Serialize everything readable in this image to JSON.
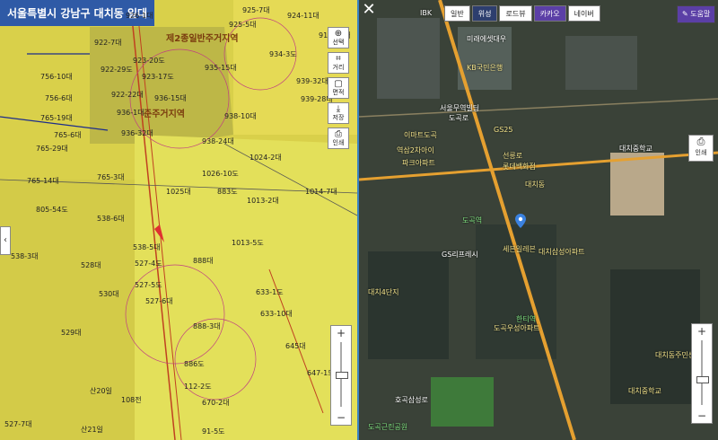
{
  "left_map": {
    "title": "서울특별시 강남구 대치동 일대",
    "zone_labels": [
      "제2종일반주거지역",
      "준주거지역"
    ],
    "parcels": [
      "926-1대",
      "925-7대",
      "925-5대",
      "922-7대",
      "923-20도",
      "922-29도",
      "923-17도",
      "922-22대",
      "936-15대",
      "935-15대",
      "934-3도",
      "939-32대",
      "936-1대",
      "936-32대",
      "938-10대",
      "938-24대",
      "765-6대",
      "765-29대",
      "765-14대",
      "765-3대",
      "756-10대",
      "756-6대",
      "765-19대",
      "1024-2대",
      "1026-10도",
      "1025대",
      "883도",
      "1013-2대",
      "1014-7대",
      "538-6대",
      "538-5대",
      "538-3대",
      "527-4도",
      "528대",
      "527-5도",
      "527-6대",
      "530대",
      "529대",
      "888대",
      "1013-5도",
      "633-1도",
      "633-10대",
      "888-3대",
      "645대",
      "886도",
      "647-1도",
      "112-2도",
      "670-2대",
      "산20일",
      "108전",
      "527-7대",
      "산21일",
      "91-5도",
      "805-54도",
      "924-11대",
      "919-17대",
      "939-28대"
    ],
    "tools": [
      {
        "icon": "⊕",
        "label": "선택"
      },
      {
        "icon": "⌗",
        "label": "거리"
      },
      {
        "icon": "▢",
        "label": "면적"
      },
      {
        "icon": "⤓",
        "label": "저장"
      },
      {
        "icon": "⎙",
        "label": "인쇄"
      }
    ],
    "zoom": {
      "plus": "+",
      "minus": "−",
      "level": 0.5
    }
  },
  "right_map": {
    "close": "✕",
    "buttons": [
      {
        "label": "일반",
        "selected": false
      },
      {
        "label": "위성",
        "selected": true
      },
      {
        "label": "로드뷰",
        "selected": false
      },
      {
        "label": "카카오",
        "selected": true
      },
      {
        "label": "네이버",
        "selected": false
      }
    ],
    "help": "도움말",
    "print": "인쇄",
    "zoom": {
      "plus": "+",
      "minus": "−",
      "level": 0.4
    },
    "labels": [
      "IBK",
      "미래에셋대우",
      "KB국민은행",
      "서울무역빌딩",
      "도곡로",
      "GS25",
      "이마트도곡",
      "역삼2차아이",
      "파크아파트",
      "선릉로",
      "롯데백화점",
      "대치동",
      "대치중학교",
      "도곡역",
      "GS리프레시",
      "세븐일레븐",
      "대치삼성아파트",
      "한티역",
      "도곡우성아파트",
      "대치4단지",
      "대치동주민센터",
      "도곡근린공원",
      "대치중학교",
      "호곡삼성로"
    ]
  }
}
